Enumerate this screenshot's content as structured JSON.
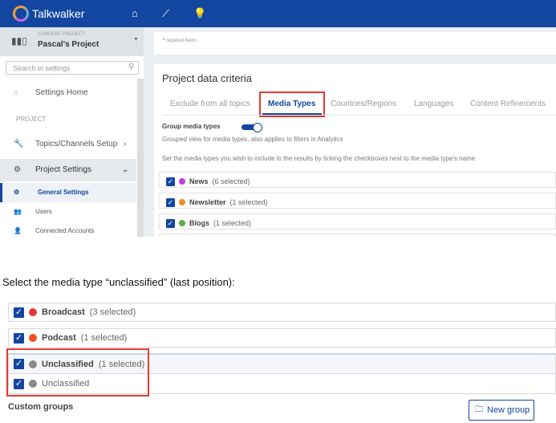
{
  "app": {
    "brand": "Talkwalker"
  },
  "sidebar": {
    "current_project_label": "CURRENT PROJECT",
    "project_name": "Pascal's Project",
    "search_placeholder": "Search in settings",
    "items": [
      {
        "label": "Settings Home"
      },
      {
        "label": "PROJECT"
      },
      {
        "label": "Topics/Channels Setup"
      },
      {
        "label": "Project Settings"
      },
      {
        "label": "General Settings"
      },
      {
        "label": "Users"
      },
      {
        "label": "Connected Accounts"
      }
    ]
  },
  "main": {
    "required_note": "required fields",
    "title": "Project data criteria",
    "tabs": [
      {
        "label": "Exclude from all topics"
      },
      {
        "label": "Media Types"
      },
      {
        "label": "Countries/Regions"
      },
      {
        "label": "Languages"
      },
      {
        "label": "Content Refinements"
      }
    ],
    "group_label": "Group media types",
    "group_desc": "Grouped view for media types, also applies to filters in Analytics",
    "instructions": "Set the media types you wish to include in the results by ticking the checkboxes next to the media type's name",
    "media": [
      {
        "name": "News",
        "count": "(6 selected)",
        "color": "#c03fd8"
      },
      {
        "name": "Newsletter",
        "count": "(1 selected)",
        "color": "#f08a24"
      },
      {
        "name": "Blogs",
        "count": "(1 selected)",
        "color": "#5cb040"
      }
    ]
  },
  "instruction_text": "Select the media type “unclassified” (last position):",
  "bottom": {
    "rows": [
      {
        "name": "Broadcast",
        "count": "(3 selected)",
        "color": "#e53935"
      },
      {
        "name": "Podcast",
        "count": "(1 selected)",
        "color": "#f4511e"
      },
      {
        "name": "Unclassified",
        "count": "(1 selected)",
        "color": "#8a8a8a"
      }
    ],
    "child": "Unclassified",
    "custom_groups": "Custom groups",
    "new_group": "New group"
  },
  "check_glyph": "✓"
}
